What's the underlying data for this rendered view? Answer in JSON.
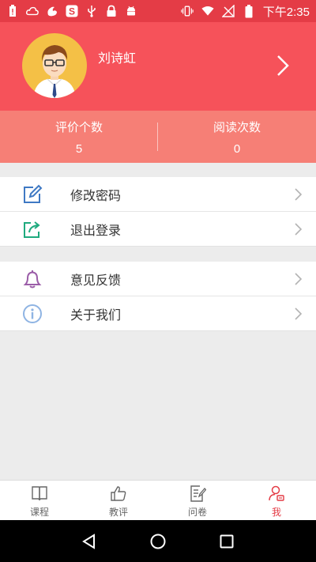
{
  "status_bar": {
    "time": "下午2:35",
    "left_icons": [
      "battery-alert-icon",
      "cloud-icon",
      "uc-browser-icon",
      "sogou-input-icon",
      "usb-icon",
      "lock-icon",
      "android-icon"
    ],
    "right_icons": [
      "vibrate-icon",
      "wifi-icon",
      "no-signal-icon",
      "battery-icon"
    ]
  },
  "profile": {
    "name": "刘诗虹",
    "avatar": "avatar-male-glasses"
  },
  "stats": [
    {
      "label": "评价个数",
      "value": "5"
    },
    {
      "label": "阅读次数",
      "value": "0"
    }
  ],
  "menu": {
    "group1": [
      {
        "label": "修改密码",
        "icon": "edit-icon"
      },
      {
        "label": "退出登录",
        "icon": "logout-icon"
      }
    ],
    "group2": [
      {
        "label": "意见反馈",
        "icon": "bell-icon"
      },
      {
        "label": "关于我们",
        "icon": "info-icon"
      }
    ]
  },
  "tabs": [
    {
      "label": "课程",
      "icon": "book-icon",
      "active": false
    },
    {
      "label": "教评",
      "icon": "thumbs-up-icon",
      "active": false
    },
    {
      "label": "问卷",
      "icon": "survey-icon",
      "active": false
    },
    {
      "label": "我",
      "icon": "user-icon",
      "active": true
    }
  ],
  "colors": {
    "status_bar": "#e43c46",
    "header": "#f6525a",
    "stats": "#f67f76",
    "active_tab": "#e43c46"
  }
}
